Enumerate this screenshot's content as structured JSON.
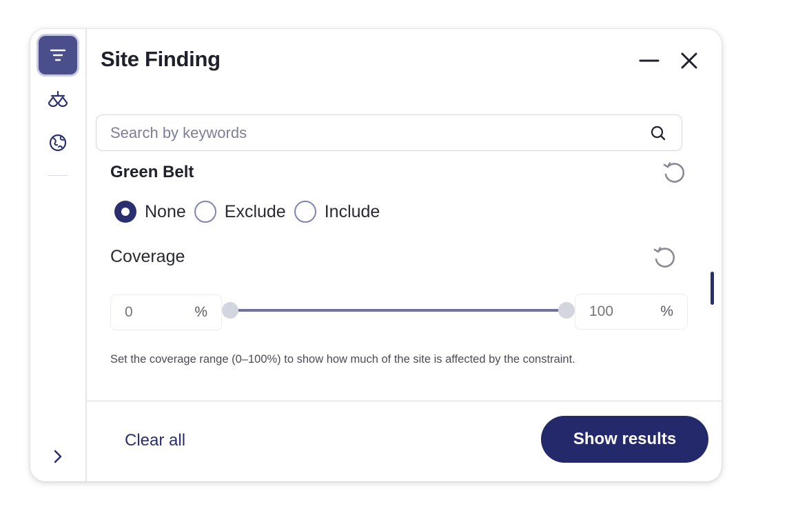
{
  "panel": {
    "title": "Site Finding"
  },
  "rail": {
    "items": [
      {
        "icon": "filter-icon",
        "active": true
      },
      {
        "icon": "scale-icon",
        "active": false
      },
      {
        "icon": "globe-icon",
        "active": false
      }
    ],
    "expand_icon": "chevron-right-icon"
  },
  "search": {
    "value": "",
    "placeholder": "Search by keywords",
    "icon": "search-icon"
  },
  "green_belt": {
    "title": "Green Belt",
    "options": [
      "None",
      "Exclude",
      "Include"
    ],
    "selected": "None"
  },
  "coverage": {
    "label": "Coverage",
    "min_value": "0",
    "max_value": "100",
    "unit": "%",
    "range_low": 0,
    "range_high": 100,
    "help_text": "Set the coverage range (0–100%) to show how much of the site is affected by the constraint."
  },
  "footer": {
    "clear_label": "Clear all",
    "submit_label": "Show results"
  },
  "colors": {
    "accent": "#23296a",
    "rail_active": "#4a4f8c",
    "slider_track": "#6e739f"
  }
}
